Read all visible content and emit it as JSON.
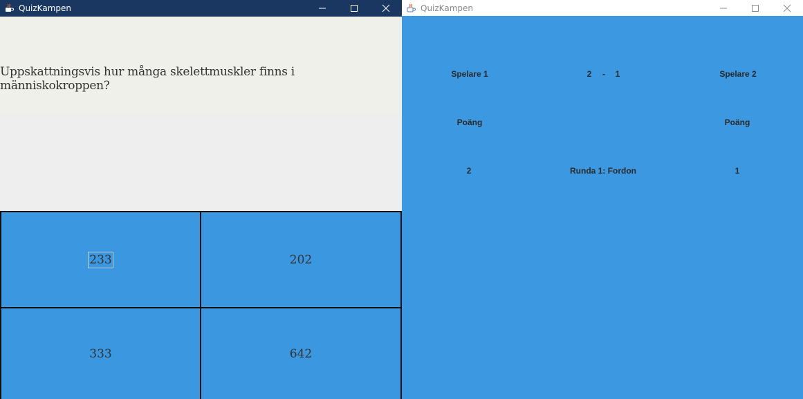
{
  "left_window": {
    "title": "QuizKampen",
    "question": "Uppskattningsvis hur många skelettmuskler finns i människokroppen?",
    "answers": [
      "233",
      "202",
      "333",
      "642"
    ],
    "focused_answer_index": 0
  },
  "right_window": {
    "title": "QuizKampen",
    "player1": "Spelare 1",
    "player2": "Spelare 2",
    "score_left": "2",
    "score_sep": "-",
    "score_right": "1",
    "points_label_1": "Poäng",
    "points_label_2": "Poäng",
    "points_1": "2",
    "points_2": "1",
    "round_label": "Runda 1: Fordon"
  },
  "icons": {
    "app": "java-cup-icon",
    "minimize": "minimize-icon",
    "maximize": "maximize-icon",
    "close": "close-icon"
  },
  "colors": {
    "accent_blue": "#3b97e0",
    "titlebar_active": "#193761",
    "question_bg": "#eff0ea"
  }
}
